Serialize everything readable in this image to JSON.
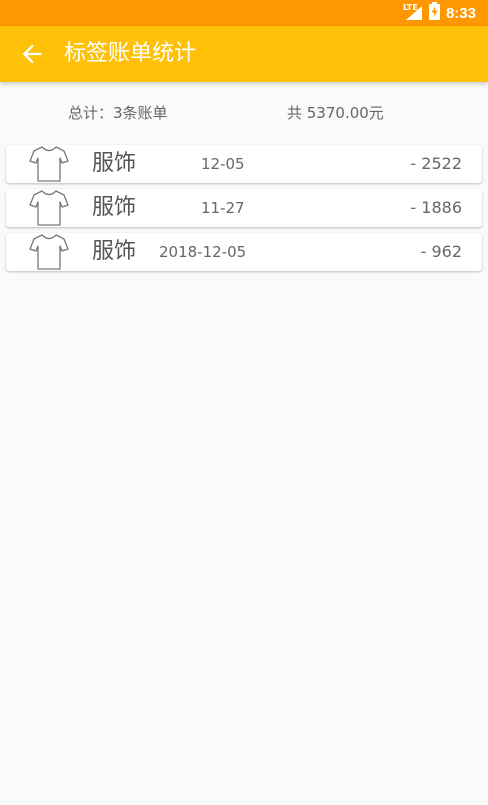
{
  "status_bar": {
    "network": "LTE",
    "time": "8:33"
  },
  "app_bar": {
    "title": "标签账单统计",
    "back_icon": "arrow-left-icon"
  },
  "summary": {
    "count_text": "总计：3条账单",
    "total_text": "共 5370.00元"
  },
  "records": [
    {
      "category": "服饰",
      "date": "12-05",
      "amount": "- 2522",
      "icon": "t-shirt-icon"
    },
    {
      "category": "服饰",
      "date": "11-27",
      "amount": "- 1886",
      "icon": "t-shirt-icon"
    },
    {
      "category": "服饰",
      "date": "2018-12-05",
      "amount": "- 962",
      "icon": "t-shirt-icon"
    }
  ],
  "colors": {
    "status_bar": "#ff9800",
    "app_bar": "#ffc107",
    "background": "#fafafa"
  }
}
